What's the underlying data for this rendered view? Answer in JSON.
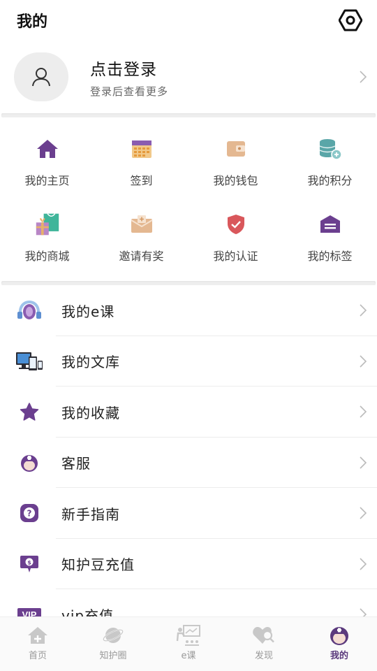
{
  "header": {
    "title": "我的"
  },
  "profile": {
    "title": "点击登录",
    "subtitle": "登录后查看更多"
  },
  "grid": [
    {
      "label": "我的主页",
      "icon": "home-icon"
    },
    {
      "label": "签到",
      "icon": "calendar-icon"
    },
    {
      "label": "我的钱包",
      "icon": "wallet-icon"
    },
    {
      "label": "我的积分",
      "icon": "coins-icon"
    },
    {
      "label": "我的商城",
      "icon": "shopping-bag-icon"
    },
    {
      "label": "邀请有奖",
      "icon": "invite-envelope-icon"
    },
    {
      "label": "我的认证",
      "icon": "shield-check-icon"
    },
    {
      "label": "我的标签",
      "icon": "tag-icon"
    }
  ],
  "list": [
    {
      "label": "我的e课",
      "icon": "course-headset-icon"
    },
    {
      "label": "我的文库",
      "icon": "library-devices-icon"
    },
    {
      "label": "我的收藏",
      "icon": "star-icon"
    },
    {
      "label": "客服",
      "icon": "nurse-icon"
    },
    {
      "label": "新手指南",
      "icon": "question-icon"
    },
    {
      "label": "知护豆充值",
      "icon": "coin-chat-icon"
    },
    {
      "label": "vip充值",
      "icon": "vip-icon",
      "vip_badge": "VIP"
    }
  ],
  "tabbar": [
    {
      "label": "首页",
      "icon": "home-tab-icon"
    },
    {
      "label": "知护圈",
      "icon": "planet-tab-icon"
    },
    {
      "label": "e课",
      "icon": "teacher-tab-icon"
    },
    {
      "label": "发现",
      "icon": "discover-tab-icon"
    },
    {
      "label": "我的",
      "icon": "me-tab-icon",
      "active": true
    }
  ],
  "colors": {
    "purple": "#6b3f8f",
    "orange": "#e7b06a",
    "teal": "#5aa6a8",
    "red": "#d9575b",
    "green": "#3fb59a",
    "tab_inactive": "#c8c8c8",
    "tab_active": "#5b3a7d"
  }
}
